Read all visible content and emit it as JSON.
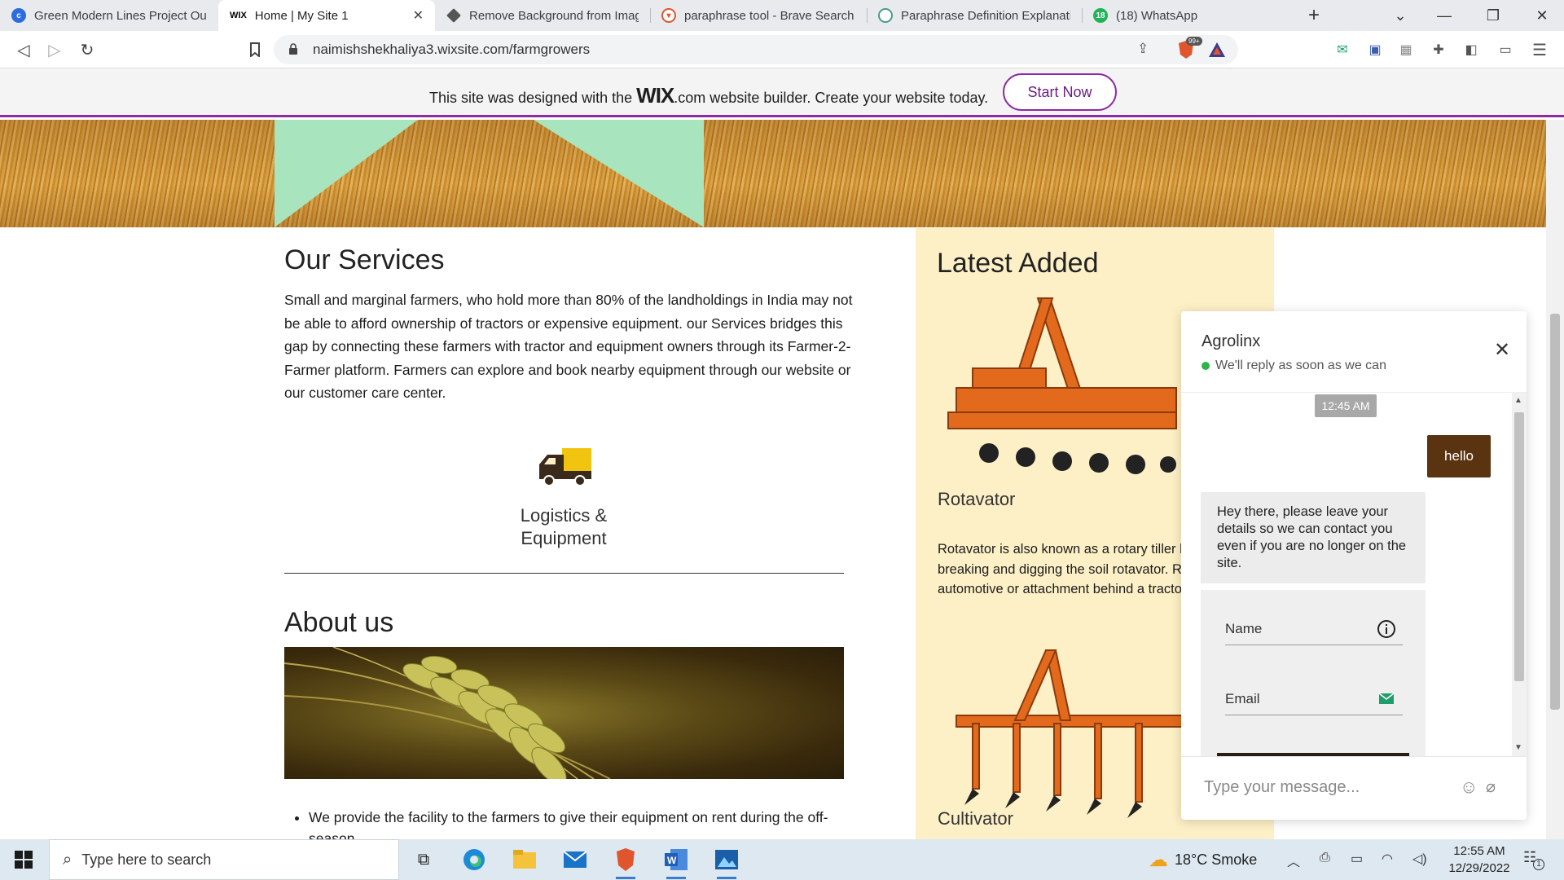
{
  "browser": {
    "tabs": [
      {
        "title": "Green Modern Lines Project Out",
        "active": false
      },
      {
        "title": "Home | My Site 1",
        "favicon_text": "WIX",
        "active": true
      },
      {
        "title": "Remove Background from Image",
        "active": false
      },
      {
        "title": "paraphrase tool - Brave Search",
        "active": false
      },
      {
        "title": "Paraphrase Definition Explanatio",
        "active": false
      },
      {
        "title": "(18) WhatsApp",
        "favicon_text": "18",
        "active": false
      }
    ],
    "new_tab": "+",
    "url": "naimishshekhaliya3.wixsite.com/farmgrowers",
    "shields_badge": "99+"
  },
  "wix_banner": {
    "text_before": "This site was designed with the",
    "logo_wix": "WIX",
    "logo_com": ".com",
    "text_after": "website builder. Create your website today.",
    "cta": "Start Now"
  },
  "services": {
    "title": "Our Services",
    "body": "Small and marginal farmers, who hold more than 80% of the landholdings in India may not be able to afford ownership of tractors or expensive equipment. our Services bridges this gap by connecting these farmers with tractor and equipment owners through its Farmer-2-Farmer platform. Farmers can explore and book nearby equipment through our website or our customer care center.",
    "feature_line1": "Logistics &",
    "feature_line2": "Equipment"
  },
  "about": {
    "title": "About us",
    "bullet": "We provide the facility to the farmers to give their equipment on rent during the off-season."
  },
  "latest": {
    "title": "Latest Added",
    "item1_name": "Rotavator",
    "item1_desc": "Rotavator is also known as a rotary tiller blades for breaking and digging the soil rotavator. Rotavators are automotive or attachment behind a tractor.",
    "item2_name": "Cultivator"
  },
  "chat": {
    "name": "Agrolinx",
    "status": "We'll reply as soon as we can",
    "time": "12:45 AM",
    "user_msg": "hello",
    "bot_msg": "Hey there, please leave your details so we can contact you even if you are no longer on the site.",
    "field_name": "Name",
    "field_email": "Email",
    "input_placeholder": "Type your message..."
  },
  "taskbar": {
    "search_placeholder": "Type here to search",
    "weather": "18°C  Smoke",
    "time": "12:55 AM",
    "date": "12/29/2022",
    "notif_count": "1"
  },
  "colors": {
    "wix_accent": "#8e2aa3",
    "mint": "#a8e4be",
    "latest_bg": "#fdf0c6",
    "chat_user_bubble": "#5a3310",
    "status_green": "#2cb34a"
  }
}
